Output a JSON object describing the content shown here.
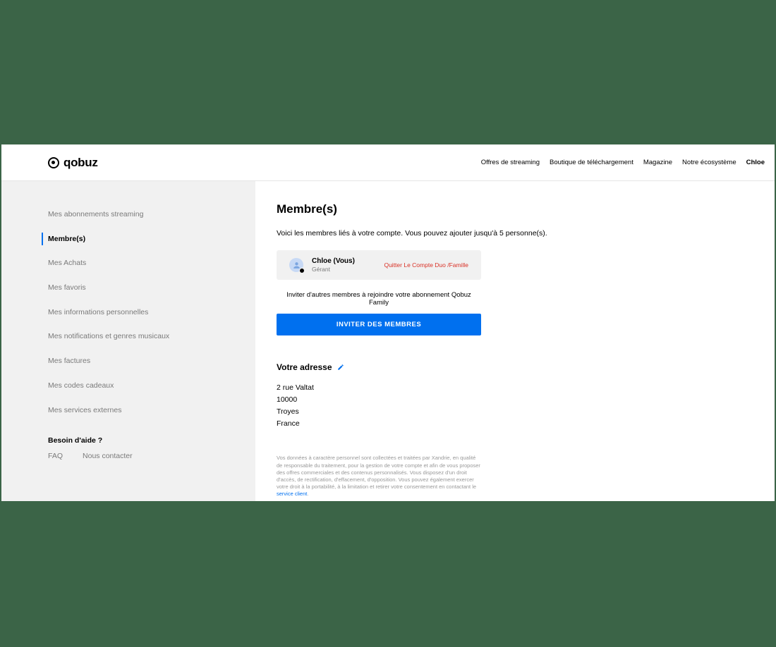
{
  "header": {
    "brand": "qobuz",
    "nav": [
      "Offres de streaming",
      "Boutique de téléchargement",
      "Magazine",
      "Notre écosystème"
    ],
    "user": "Chloe"
  },
  "sidebar": {
    "items": [
      "Mes abonnements streaming",
      "Membre(s)",
      "Mes Achats",
      "Mes favoris",
      "Mes informations personnelles",
      "Mes notifications et genres musicaux",
      "Mes factures",
      "Mes codes cadeaux",
      "Mes services externes"
    ],
    "active_index": 1,
    "help_title": "Besoin d'aide ?",
    "help_links": [
      "FAQ",
      "Nous contacter"
    ]
  },
  "main": {
    "title": "Membre(s)",
    "intro": "Voici les membres liés à votre compte. Vous pouvez ajouter jusqu'à 5 personne(s).",
    "member": {
      "name": "Chloe (Vous)",
      "role": "Gérant",
      "leave": "Quitter Le Compte Duo /Famille"
    },
    "invite_text": "Inviter d'autres membres à rejoindre votre abonnement Qobuz Family",
    "invite_button": "INVITER DES MEMBRES",
    "address_title": "Votre adresse",
    "address": {
      "line1": "2 rue Valtat",
      "line2": "10000",
      "line3": "Troyes",
      "line4": "France"
    },
    "legal_text": "Vos données à caractère personnel sont collectées et traitées par Xandrie, en qualité de responsable du traitement, pour la gestion de votre compte et afin de vous proposer des offres commerciales et des contenus personnalisés. Vous disposez d'un droit d'accès, de rectification, d'effacement, d'opposition. Vous pouvez également exercer votre droit à la portabilité, à la limitation et retirer votre consentement en contactant le ",
    "legal_link": "service client"
  }
}
